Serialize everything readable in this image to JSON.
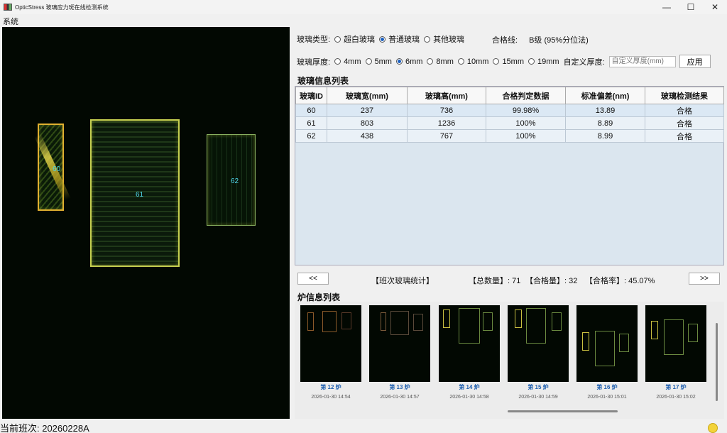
{
  "window": {
    "title": "OpticStress 玻璃应力斑在线检测系统",
    "min": "—",
    "max": "☐",
    "close": "✕"
  },
  "menu": {
    "system": "系统"
  },
  "viewer": {
    "labels": [
      "60",
      "61",
      "62"
    ]
  },
  "glass_type": {
    "label": "玻璃类型:",
    "options": [
      {
        "label": "超白玻璃",
        "selected": false
      },
      {
        "label": "普通玻璃",
        "selected": true
      },
      {
        "label": "其他玻璃",
        "selected": false
      }
    ]
  },
  "pass_line": {
    "label": "合格线:",
    "value": "B级 (95%分位法)"
  },
  "thickness": {
    "label": "玻璃厚度:",
    "options": [
      {
        "label": "4mm",
        "selected": false
      },
      {
        "label": "5mm",
        "selected": false
      },
      {
        "label": "6mm",
        "selected": true
      },
      {
        "label": "8mm",
        "selected": false
      },
      {
        "label": "10mm",
        "selected": false
      },
      {
        "label": "15mm",
        "selected": false
      },
      {
        "label": "19mm",
        "selected": false
      }
    ],
    "custom_label": "自定义厚度:",
    "custom_placeholder": "自定义厚度(mm)",
    "apply": "应用"
  },
  "glass_table": {
    "title": "玻璃信息列表",
    "headers": [
      "玻璃ID",
      "玻璃宽(mm)",
      "玻璃高(mm)",
      "合格判定数据",
      "标准偏差(nm)",
      "玻璃检测结果"
    ],
    "rows": [
      [
        "60",
        "237",
        "736",
        "99.98%",
        "13.89",
        "合格"
      ],
      [
        "61",
        "803",
        "1236",
        "100%",
        "8.89",
        "合格"
      ],
      [
        "62",
        "438",
        "767",
        "100%",
        "8.99",
        "合格"
      ]
    ]
  },
  "stats": {
    "prev": "<<",
    "next": ">>",
    "title": "【班次玻璃统计】",
    "total": "【总数量】: 71",
    "passed": "【合格量】: 32",
    "rate": "【合格率】: 45.07%"
  },
  "furnace": {
    "title": "炉信息列表",
    "items": [
      {
        "label": "第 12 炉",
        "time": "2026-01-30 14:54"
      },
      {
        "label": "第 13 炉",
        "time": "2026-01-30 14:57"
      },
      {
        "label": "第 14 炉",
        "time": "2026-01-30 14:58"
      },
      {
        "label": "第 15 炉",
        "time": "2026-01-30 14:59"
      },
      {
        "label": "第 16 炉",
        "time": "2026-01-30 15:01"
      },
      {
        "label": "第 17 炉",
        "time": "2026-01-30 15:02"
      }
    ]
  },
  "status": {
    "text": "当前班次: 20260228A",
    "indicator_color": "#f3d33a"
  }
}
